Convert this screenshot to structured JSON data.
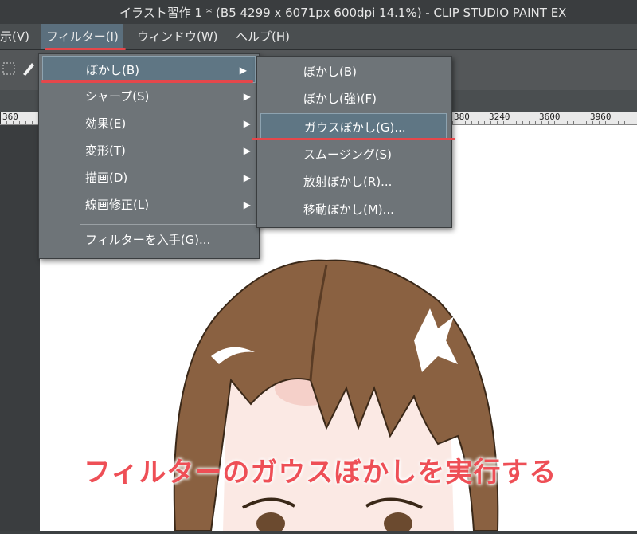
{
  "window": {
    "title": "イラスト習作 1 * (B5 4299 x 6071px 600dpi 14.1%)  - CLIP STUDIO PAINT EX"
  },
  "menubar": {
    "items": [
      {
        "label": "示(V)"
      },
      {
        "label": "フィルター(I)"
      },
      {
        "label": "ウィンドウ(W)"
      },
      {
        "label": "ヘルプ(H)"
      }
    ]
  },
  "ruler": {
    "ticks": [
      "360",
      "380",
      "3240",
      "3600",
      "3960"
    ]
  },
  "filter_menu": {
    "items": [
      {
        "label": "ぼかし(B)",
        "arrow": "▶"
      },
      {
        "label": "シャープ(S)",
        "arrow": "▶"
      },
      {
        "label": "効果(E)",
        "arrow": "▶"
      },
      {
        "label": "変形(T)",
        "arrow": "▶"
      },
      {
        "label": "描画(D)",
        "arrow": "▶"
      },
      {
        "label": "線画修正(L)",
        "arrow": "▶"
      }
    ],
    "footer": "フィルターを入手(G)..."
  },
  "blur_submenu": {
    "items": [
      {
        "label": "ぼかし(B)"
      },
      {
        "label": "ぼかし(強)(F)"
      },
      {
        "label": "ガウスぼかし(G)..."
      },
      {
        "label": "スムージング(S)"
      },
      {
        "label": "放射ぼかし(R)..."
      },
      {
        "label": "移動ぼかし(M)..."
      }
    ]
  },
  "caption": "フィルターのガウスぼかしを実行する",
  "colors": {
    "highlight": "#5f7684",
    "annotation_red": "#e5474b",
    "hair": "#8a6141"
  }
}
